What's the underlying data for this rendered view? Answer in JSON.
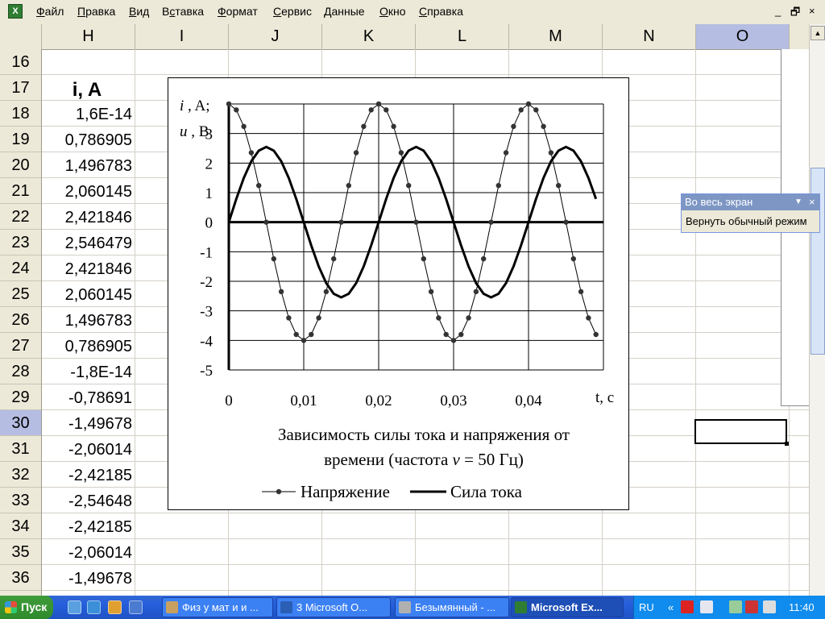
{
  "menu": {
    "items": [
      "Файл",
      "Правка",
      "Вид",
      "Вставка",
      "Формат",
      "Сервис",
      "Данные",
      "Окно",
      "Справка"
    ],
    "underlined": [
      "Ф",
      "П",
      "В",
      "с",
      "Ф",
      "С",
      "Д",
      "О",
      "С"
    ],
    "minimize": "_",
    "restore": "🗗",
    "close": "×"
  },
  "columns": [
    "H",
    "I",
    "J",
    "K",
    "L",
    "M",
    "N",
    "O"
  ],
  "selected_column": "O",
  "rows": [
    "16",
    "17",
    "18",
    "19",
    "20",
    "21",
    "22",
    "23",
    "24",
    "25",
    "26",
    "27",
    "28",
    "29",
    "30",
    "31",
    "32",
    "33",
    "34",
    "35",
    "36"
  ],
  "selected_row": "30",
  "column_h": {
    "header": "i, A",
    "values": [
      "1,6E-14",
      "0,786905",
      "1,496783",
      "2,060145",
      "2,421846",
      "2,546479",
      "2,421846",
      "2,060145",
      "1,496783",
      "0,786905",
      "-1,8E-14",
      "-0,78691",
      "-1,49678",
      "-2,06014",
      "-2,42185",
      "-2,54648",
      "-2,42185",
      "-2,06014",
      "-1,49678"
    ]
  },
  "chart_data": {
    "type": "line",
    "title": "Зависимость силы тока и напряжения от времени (частота ν = 50 Гц)",
    "title_line1": "Зависимость силы тока и напряжения от",
    "title_line2_a": "времени (частота",
    "title_line2_nu": "ν",
    "title_line2_b": " = 50 Гц)",
    "ylabel_line1_i": "i",
    "ylabel_line1_rest": ", A;",
    "ylabel_line2_u": "u",
    "ylabel_line2_rest": ", B",
    "xlabel": "t, c",
    "xlim": [
      0,
      0.05
    ],
    "ylim": [
      -5,
      4
    ],
    "x_tick_labels": [
      "0",
      "0,01",
      "0,02",
      "0,03",
      "0,04"
    ],
    "x_ticks": [
      0,
      0.01,
      0.02,
      0.03,
      0.04
    ],
    "y_tick_labels": [
      "3",
      "2",
      "1",
      "0",
      "-1",
      "-2",
      "-3",
      "-4",
      "-5"
    ],
    "y_ticks": [
      3,
      2,
      1,
      0,
      -1,
      -2,
      -3,
      -4,
      -5
    ],
    "grid": true,
    "legend_placement": "bottom",
    "series": [
      {
        "name": "Напряжение",
        "marker": "dot",
        "x": [
          0,
          0.001,
          0.002,
          0.003,
          0.004,
          0.005,
          0.006,
          0.007,
          0.008,
          0.009,
          0.01,
          0.011,
          0.012,
          0.013,
          0.014,
          0.015,
          0.016,
          0.017,
          0.018,
          0.019,
          0.02,
          0.021,
          0.022,
          0.023,
          0.024,
          0.025,
          0.026,
          0.027,
          0.028,
          0.029,
          0.03,
          0.031,
          0.032,
          0.033,
          0.034,
          0.035,
          0.036,
          0.037,
          0.038,
          0.039,
          0.04,
          0.041,
          0.042,
          0.043,
          0.044,
          0.045,
          0.046,
          0.047,
          0.048,
          0.049
        ],
        "y": [
          4,
          3.8,
          3.24,
          2.35,
          1.24,
          0,
          -1.24,
          -2.35,
          -3.24,
          -3.8,
          -4,
          -3.8,
          -3.24,
          -2.35,
          -1.24,
          0,
          1.24,
          2.35,
          3.24,
          3.8,
          4,
          3.8,
          3.24,
          2.35,
          1.24,
          0,
          -1.24,
          -2.35,
          -3.24,
          -3.8,
          -4,
          -3.8,
          -3.24,
          -2.35,
          -1.24,
          0,
          1.24,
          2.35,
          3.24,
          3.8,
          4,
          3.8,
          3.24,
          2.35,
          1.24,
          0,
          -1.24,
          -2.35,
          -3.24,
          -3.8
        ]
      },
      {
        "name": "Сила тока",
        "marker": "none",
        "x": [
          0,
          0.001,
          0.002,
          0.003,
          0.004,
          0.005,
          0.006,
          0.007,
          0.008,
          0.009,
          0.01,
          0.011,
          0.012,
          0.013,
          0.014,
          0.015,
          0.016,
          0.017,
          0.018,
          0.019,
          0.02,
          0.021,
          0.022,
          0.023,
          0.024,
          0.025,
          0.026,
          0.027,
          0.028,
          0.029,
          0.03,
          0.031,
          0.032,
          0.033,
          0.034,
          0.035,
          0.036,
          0.037,
          0.038,
          0.039,
          0.04,
          0.041,
          0.042,
          0.043,
          0.044,
          0.045,
          0.046,
          0.047,
          0.048,
          0.049
        ],
        "y": [
          0,
          0.787,
          1.497,
          2.06,
          2.422,
          2.546,
          2.422,
          2.06,
          1.497,
          0.787,
          0,
          -0.787,
          -1.497,
          -2.06,
          -2.422,
          -2.546,
          -2.422,
          -2.06,
          -1.497,
          -0.787,
          0,
          0.787,
          1.497,
          2.06,
          2.422,
          2.546,
          2.422,
          2.06,
          1.497,
          0.787,
          0,
          -0.787,
          -1.497,
          -2.06,
          -2.422,
          -2.546,
          -2.422,
          -2.06,
          -1.497,
          -0.787,
          0,
          0.787,
          1.497,
          2.06,
          2.422,
          2.546,
          2.422,
          2.06,
          1.497,
          0.787
        ]
      }
    ]
  },
  "fullscreen_toolbar": {
    "title": "Во весь экран",
    "button": "Вернуть обычный режим"
  },
  "taskbar": {
    "start": "Пуск",
    "tasks": [
      {
        "label": "Физ у мат и и ...",
        "active": false
      },
      {
        "label": "3 Microsoft O...",
        "active": false
      },
      {
        "label": "Безымянный - ...",
        "active": false
      },
      {
        "label": "Microsoft Ex...",
        "active": true
      }
    ],
    "language": "RU",
    "tray_arrow": "«",
    "clock": "11:40"
  },
  "colors": {
    "selection": "#b6bde2",
    "taskbar": "#245edb",
    "start": "#2f8a2b"
  }
}
